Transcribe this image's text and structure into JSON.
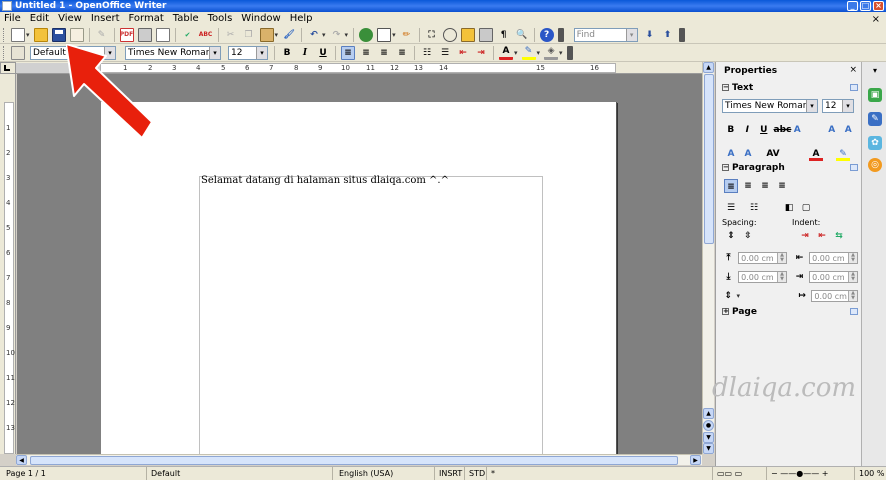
{
  "window": {
    "title": "Untitled 1 - OpenOffice Writer"
  },
  "menu": [
    "File",
    "Edit",
    "View",
    "Insert",
    "Format",
    "Table",
    "Tools",
    "Window",
    "Help"
  ],
  "toolbar": {
    "find_placeholder": "Find"
  },
  "formatting": {
    "style": "Default",
    "font": "Times New Roman",
    "size": "12"
  },
  "ruler": {
    "h_ticks": [
      "1",
      "2",
      "3",
      "4",
      "5",
      "6",
      "7",
      "8",
      "9",
      "10",
      "11",
      "12",
      "13",
      "14",
      "15",
      "16"
    ],
    "v_ticks": [
      "1",
      "2",
      "3",
      "4",
      "5",
      "6",
      "7",
      "8",
      "9",
      "10",
      "11",
      "12",
      "13"
    ]
  },
  "document": {
    "text": "Selamat datang di halaman situs dlaiqa.com ^.^"
  },
  "sidebar": {
    "title": "Properties",
    "text_section": "Text",
    "font": "Times New Roman",
    "size": "12",
    "paragraph_section": "Paragraph",
    "spacing_label": "Spacing:",
    "indent_label": "Indent:",
    "spin_value": "0.00 cm",
    "page_section": "Page"
  },
  "status": {
    "page": "Page 1 / 1",
    "style": "Default",
    "language": "English (USA)",
    "mode": "INSRT",
    "selection": "STD",
    "modified": "*",
    "zoom": "100 %"
  },
  "watermark": "dlaiqa.com",
  "colors": {
    "titlebar": "#0a58d8",
    "arrow": "#e8200c",
    "page": "#ffffff",
    "canvas": "#808080"
  }
}
